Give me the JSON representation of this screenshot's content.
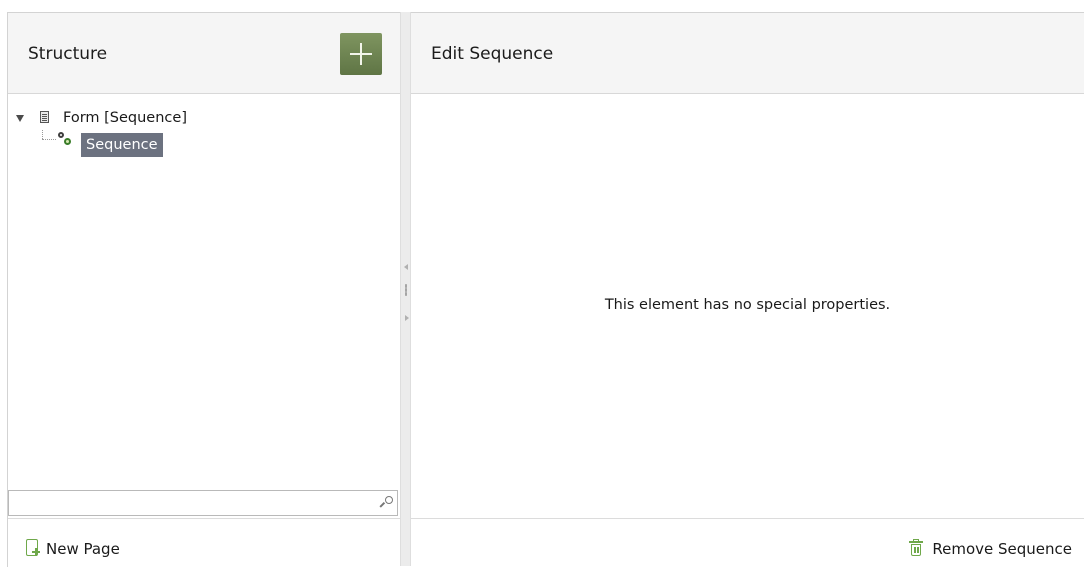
{
  "left_panel": {
    "title": "Structure",
    "add_button_icon": "plus-icon",
    "tree": {
      "root_label": "Form [Sequence]",
      "children": [
        {
          "label": "Sequence",
          "selected": true
        }
      ]
    },
    "search": {
      "value": "",
      "placeholder": ""
    },
    "footer": {
      "new_page_label": "New Page"
    }
  },
  "right_panel": {
    "title": "Edit Sequence",
    "message": "This element has no special properties.",
    "footer": {
      "remove_label": "Remove Sequence"
    }
  },
  "colors": {
    "accent_green": "#6fa84a",
    "add_button": "#6f8553",
    "selection": "#6c7280"
  }
}
